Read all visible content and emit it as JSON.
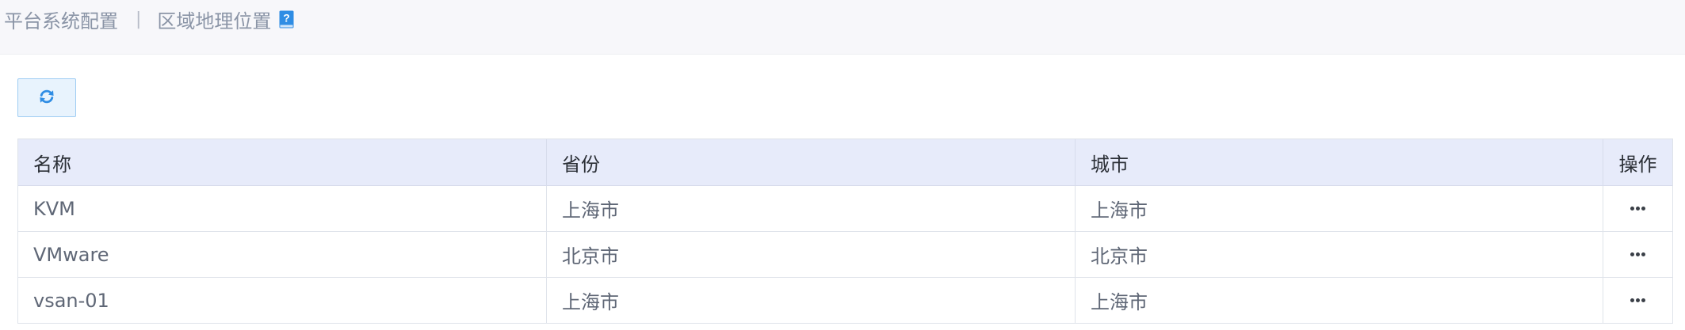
{
  "breadcrumb": {
    "parent": "平台系统配置",
    "separator": "|",
    "current": "区域地理位置",
    "help_icon": "help-book-icon"
  },
  "toolbar": {
    "refresh_icon": "refresh-icon"
  },
  "table": {
    "columns": [
      "名称",
      "省份",
      "城市",
      "操作"
    ],
    "rows": [
      {
        "name": "KVM",
        "province": "上海市",
        "city": "上海市",
        "action_icon": "more-icon"
      },
      {
        "name": "VMware",
        "province": "北京市",
        "city": "北京市",
        "action_icon": "more-icon"
      },
      {
        "name": "vsan-01",
        "province": "上海市",
        "city": "上海市",
        "action_icon": "more-icon"
      }
    ]
  },
  "colors": {
    "header_bg": "#e7ebfa",
    "topbar_bg": "#f7f7fa",
    "button_bg": "#e8f3fd",
    "button_border": "#9fcdf3",
    "accent": "#2f8de4"
  }
}
